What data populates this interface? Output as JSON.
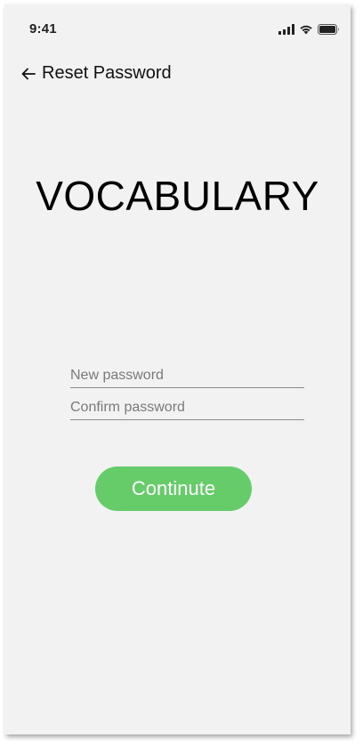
{
  "status_bar": {
    "time": "9:41",
    "icons": [
      "cellular-signal-icon",
      "wifi-icon",
      "battery-icon"
    ]
  },
  "header": {
    "back_icon": "arrow-left-icon",
    "title": "Reset Password"
  },
  "app": {
    "name": "VOCABULARY"
  },
  "form": {
    "new_password_placeholder": "New password",
    "confirm_password_placeholder": "Confirm password",
    "continue_label": "Continute"
  },
  "colors": {
    "background": "#f2f2f2",
    "accent": "#66cc6a",
    "button_text": "#ffffff"
  }
}
